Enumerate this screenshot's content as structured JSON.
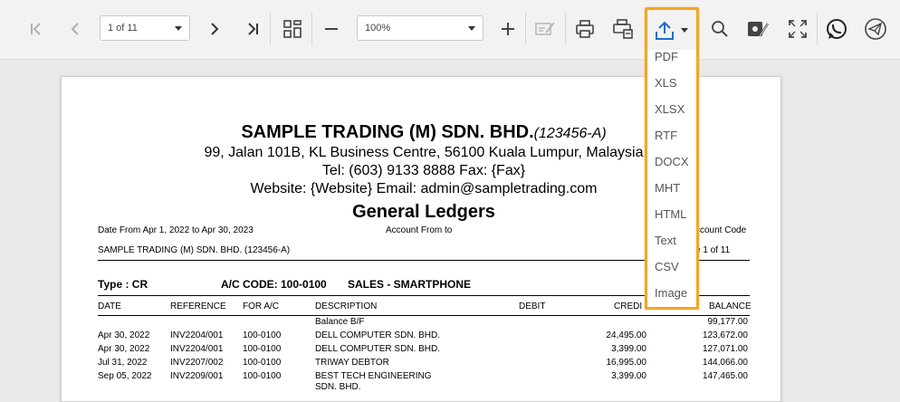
{
  "toolbar": {
    "page_indicator": "1 of 11",
    "zoom": "100%"
  },
  "export_menu": {
    "items": [
      "PDF",
      "XLS",
      "XLSX",
      "RTF",
      "DOCX",
      "MHT",
      "HTML",
      "Text",
      "CSV",
      "Image"
    ]
  },
  "report": {
    "company_name": "SAMPLE TRADING (M) SDN. BHD.",
    "company_reg": "(123456-A)",
    "address": "99, Jalan 101B, KL Business Centre, 56100 Kuala Lumpur, Malaysia",
    "contact": "Tel: (603) 9133 8888  Fax: {Fax}",
    "web": "Website: {Website}  Email: admin@sampletrading.com",
    "title": "General Ledgers",
    "date_range": "Date From Apr 1, 2022 to Apr 30, 2023",
    "account_from": "Account From to",
    "account_code_fragment": "ccount Code",
    "company_line": "SAMPLE TRADING (M) SDN. BHD. (123456-A)",
    "page_fragment": "e 1 of 11",
    "type_label": "Type : CR",
    "ac_code": "A/C CODE: 100-0100",
    "ac_name": "SALES - SMARTPHONE",
    "headers": {
      "date": "DATE",
      "reference": "REFERENCE",
      "for_ac": "FOR A/C",
      "description": "DESCRIPTION",
      "debit": "DEBIT",
      "credit": "CREDI",
      "balance": "BALANCE"
    },
    "rows": [
      {
        "date": "",
        "ref": "",
        "forac": "",
        "desc": "Balance B/F",
        "credit": "",
        "balance": "99,177.00"
      },
      {
        "date": "Apr 30, 2022",
        "ref": "INV2204/001",
        "forac": "100-0100",
        "desc": "DELL COMPUTER SDN. BHD.",
        "credit": "24,495.00",
        "balance": "123,672.00"
      },
      {
        "date": "Apr 30, 2022",
        "ref": "INV2204/001",
        "forac": "100-0100",
        "desc": "DELL COMPUTER SDN. BHD.",
        "credit": "3,399.00",
        "balance": "127,071.00"
      },
      {
        "date": "Jul 31, 2022",
        "ref": "INV2207/002",
        "forac": "100-0100",
        "desc": "TRIWAY DEBTOR",
        "credit": "16,995.00",
        "balance": "144,066.00"
      },
      {
        "date": "Sep 05, 2022",
        "ref": "INV2209/001",
        "forac": "100-0100",
        "desc": "BEST TECH ENGINEERING",
        "credit": "3,399.00",
        "balance": "147,465.00"
      },
      {
        "date": "",
        "ref": "",
        "forac": "",
        "desc": "SDN. BHD.",
        "credit": "",
        "balance": ""
      }
    ]
  }
}
